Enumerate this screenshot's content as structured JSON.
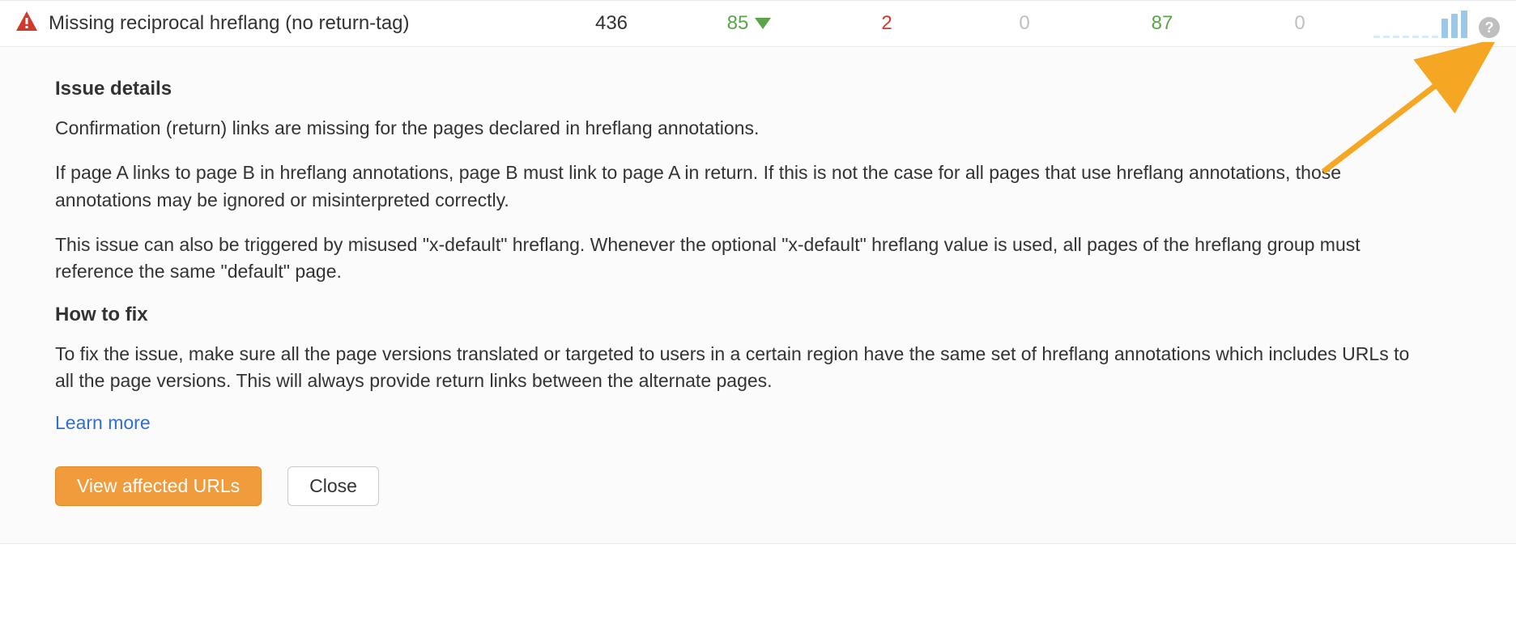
{
  "row": {
    "name": "Missing reciprocal hreflang (no return-tag)",
    "col_total": "436",
    "col_change": "85",
    "col_red": "2",
    "col_zero1": "0",
    "col_green2": "87",
    "col_zero2": "0",
    "sparkline_heights": [
      3,
      3,
      3,
      3,
      3,
      3,
      3,
      24,
      30,
      34
    ],
    "help_glyph": "?"
  },
  "details": {
    "heading": "Issue details",
    "p1": "Confirmation (return) links are missing for the pages declared in hreflang annotations.",
    "p2": "If page A links to page B in hreflang annotations, page B must link to page A in return. If this is not the case for all pages that use hreflang annotations, those annotations may be ignored or misinterpreted correctly.",
    "p3": "This issue can also be triggered by misused \"x-default\" hreflang. Whenever the optional \"x-default\" hreflang value is used, all pages of the hreflang group must reference the same \"default\" page.",
    "fix_heading": "How to fix",
    "fix_p": "To fix the issue, make sure all the page versions translated or targeted to users in a certain region have the same set of hreflang annotations which includes URLs to all the page versions. This will always provide return links between the alternate pages.",
    "learn_more": "Learn more",
    "btn_primary": "View affected URLs",
    "btn_close": "Close"
  },
  "colors": {
    "accent_orange": "#f19c3c",
    "green": "#5aa54a",
    "red": "#d03a2b",
    "link_blue": "#2f6fd0"
  }
}
